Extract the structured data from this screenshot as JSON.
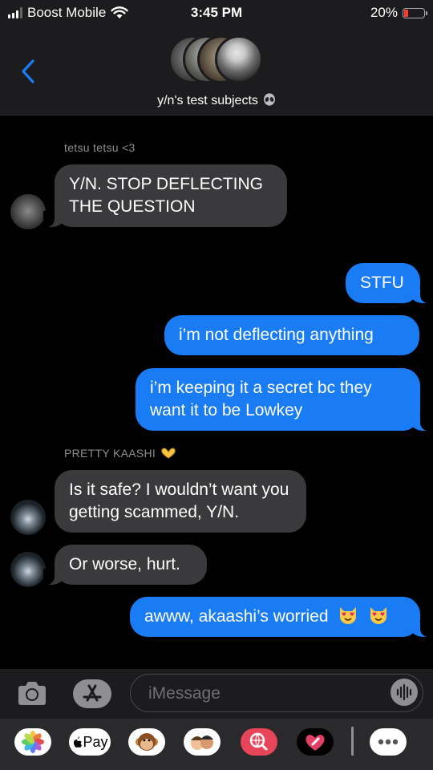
{
  "status_bar": {
    "carrier": "Boost Mobile",
    "time": "3:45 PM",
    "battery_percent": "20%"
  },
  "header": {
    "group_name": "y/n's test subjects",
    "title_icon": "alien-icon",
    "back_icon": "chevron-left-icon"
  },
  "conversation": {
    "sender_1": "tetsu tetsu <3",
    "sender_2": "PRETTY KAASHI",
    "sender_2_icon": "heart-hands-icon",
    "messages": [
      {
        "direction": "incoming",
        "text": "Y/N. STOP DEFLECTING THE QUESTION"
      },
      {
        "direction": "outgoing",
        "text": "STFU"
      },
      {
        "direction": "outgoing",
        "text": "i’m not deflecting anything"
      },
      {
        "direction": "outgoing",
        "text": "i’m keeping it a secret bc they want it to be Lowkey"
      },
      {
        "direction": "incoming",
        "text": "Is it safe? I wouldn’t want you getting scammed, Y/N."
      },
      {
        "direction": "incoming",
        "text": "Or worse, hurt."
      },
      {
        "direction": "outgoing",
        "text": "awww, akaashi’s worried"
      }
    ],
    "last_message_emoji": "heart-eyes-cat-icon"
  },
  "input": {
    "placeholder": "iMessage"
  },
  "app_drawer": {
    "apple_pay_label": "Pay",
    "apps": [
      "photos-icon",
      "apple-pay-icon",
      "monkey-memoji-icon",
      "memoji-icon",
      "web-search-icon",
      "digital-touch-icon",
      "more-apps-icon"
    ]
  },
  "colors": {
    "outgoing_bubble": "#1a7cf5",
    "incoming_bubble": "#3a3a3c",
    "background": "#000000",
    "bar_background": "#1c1c1e",
    "battery_low": "#ff3b30"
  }
}
